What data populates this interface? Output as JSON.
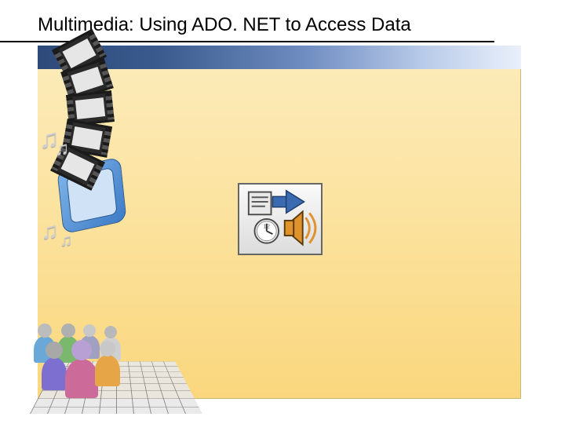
{
  "slide": {
    "title": "Multimedia:  Using ADO. NET to Access Data"
  },
  "icons": {
    "play_button": "multimedia-play-icon",
    "music_note": "♫"
  }
}
